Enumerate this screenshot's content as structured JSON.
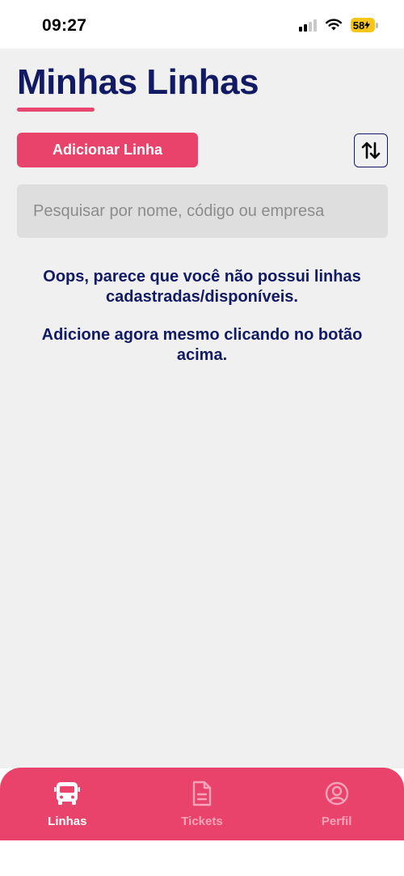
{
  "status_bar": {
    "time": "09:27",
    "battery": "58"
  },
  "page": {
    "title": "Minhas Linhas",
    "add_button_label": "Adicionar Linha",
    "sort_icon": "sort-arrows-icon",
    "search_placeholder": "Pesquisar por nome, código ou empresa",
    "search_value": "",
    "empty_message_1": "Oops, parece que você não possui linhas cadastradas/disponíveis.",
    "empty_message_2": "Adicione agora mesmo clicando no botão acima."
  },
  "bottom_nav": {
    "items": [
      {
        "label": "Linhas",
        "icon": "bus-icon",
        "active": true
      },
      {
        "label": "Tickets",
        "icon": "document-icon",
        "active": false
      },
      {
        "label": "Perfil",
        "icon": "user-circle-icon",
        "active": false
      }
    ]
  },
  "colors": {
    "primary": "#ea436b",
    "title": "#111a63",
    "background": "#f0f0f0",
    "search_bg": "#dedede"
  }
}
